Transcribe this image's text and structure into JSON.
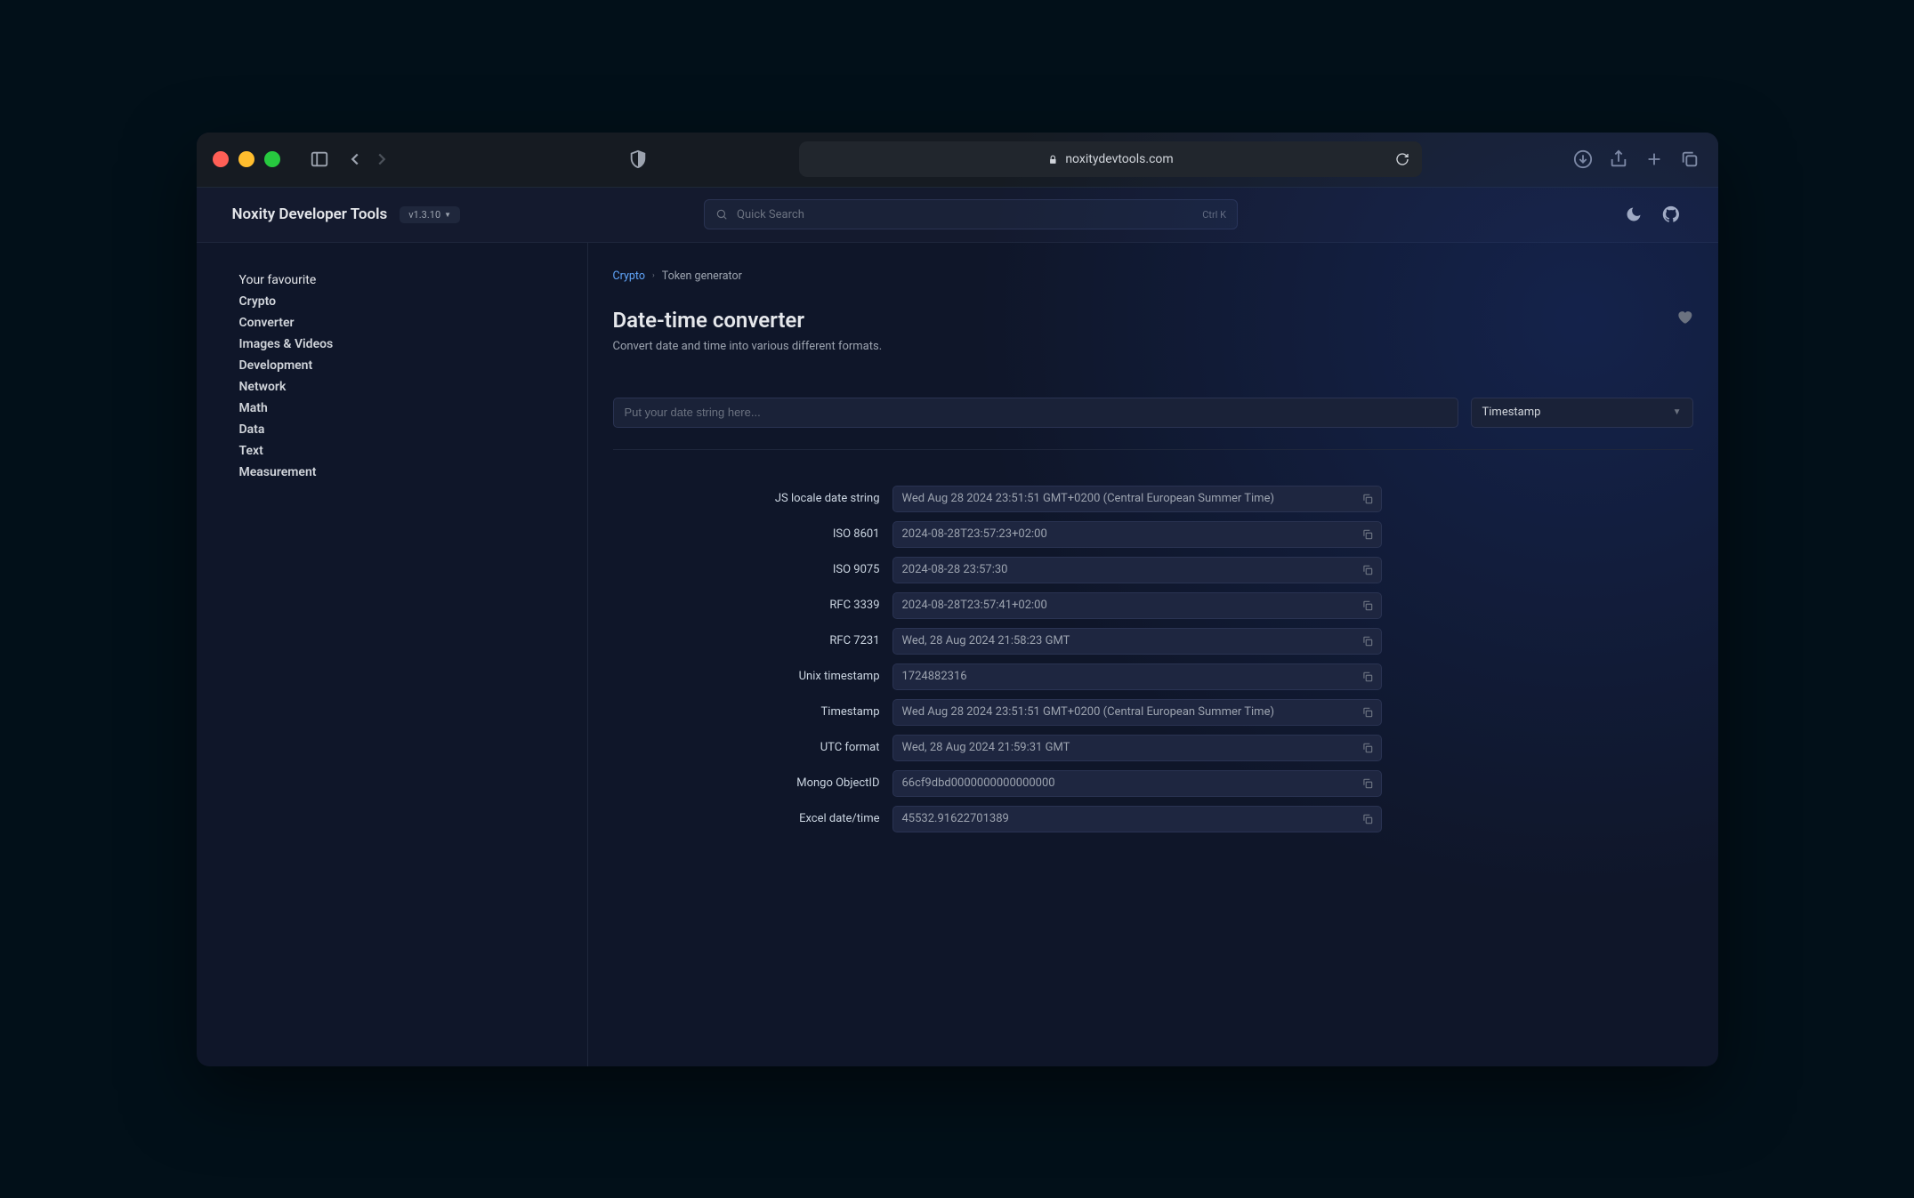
{
  "browser": {
    "url": "noxitydevtools.com"
  },
  "app": {
    "title": "Noxity Developer Tools",
    "version": "v1.3.10",
    "search_placeholder": "Quick Search",
    "search_shortcut": "Ctrl K"
  },
  "sidebar": {
    "items": [
      "Your favourite",
      "Crypto",
      "Converter",
      "Images & Videos",
      "Development",
      "Network",
      "Math",
      "Data",
      "Text",
      "Measurement"
    ]
  },
  "breadcrumb": {
    "parent": "Crypto",
    "current": "Token generator"
  },
  "page": {
    "title": "Date-time converter",
    "desc": "Convert date and time into various different formats.",
    "input_placeholder": "Put your date string here...",
    "select_value": "Timestamp"
  },
  "formats": [
    {
      "label": "JS locale date string",
      "value": "Wed Aug 28 2024 23:51:51 GMT+0200 (Central European Summer Time)"
    },
    {
      "label": "ISO 8601",
      "value": "2024-08-28T23:57:23+02:00"
    },
    {
      "label": "ISO 9075",
      "value": "2024-08-28 23:57:30"
    },
    {
      "label": "RFC 3339",
      "value": "2024-08-28T23:57:41+02:00"
    },
    {
      "label": "RFC 7231",
      "value": "Wed, 28 Aug 2024 21:58:23 GMT"
    },
    {
      "label": "Unix timestamp",
      "value": "1724882316"
    },
    {
      "label": "Timestamp",
      "value": "Wed Aug 28 2024 23:51:51 GMT+0200 (Central European Summer Time)"
    },
    {
      "label": "UTC format",
      "value": "Wed, 28 Aug 2024 21:59:31 GMT"
    },
    {
      "label": "Mongo ObjectID",
      "value": "66cf9dbd0000000000000000"
    },
    {
      "label": "Excel date/time",
      "value": "45532.91622701389"
    }
  ]
}
